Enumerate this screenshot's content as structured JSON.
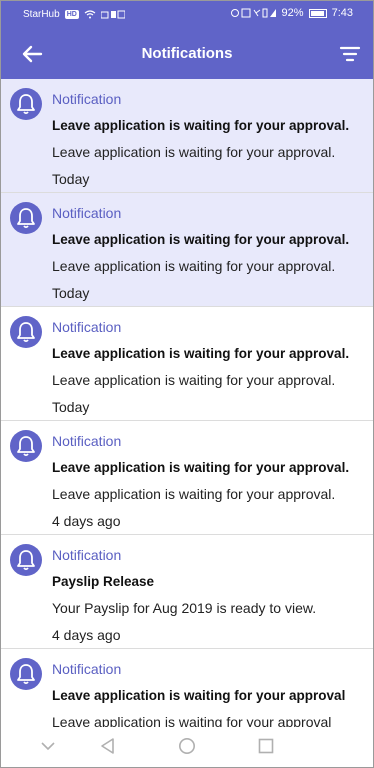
{
  "status_bar": {
    "carrier": "StarHub",
    "network_badge": "HD",
    "battery": "92%",
    "time": "7:43"
  },
  "app_bar": {
    "title": "Notifications",
    "back_icon": "arrow-left-icon",
    "filter_icon": "filter-icon"
  },
  "notifications": [
    {
      "category": "Notification",
      "subject": "Leave application is waiting for your approval.",
      "body": "Leave application is waiting for your approval.",
      "time": "Today",
      "unread": true
    },
    {
      "category": "Notification",
      "subject": "Leave application is waiting for your approval.",
      "body": "Leave application is waiting for your approval.",
      "time": "Today",
      "unread": true
    },
    {
      "category": "Notification",
      "subject": "Leave application is waiting for your approval.",
      "body": "Leave application is waiting for your approval.",
      "time": "Today",
      "unread": false
    },
    {
      "category": "Notification",
      "subject": "Leave application is waiting for your approval.",
      "body": "Leave application is waiting for your approval.",
      "time": "4 days ago",
      "unread": false
    },
    {
      "category": "Notification",
      "subject": "Payslip Release",
      "body": "Your Payslip for Aug 2019 is ready to view.",
      "time": "4 days ago",
      "unread": false
    },
    {
      "category": "Notification",
      "subject": "Leave application is waiting for your approval",
      "body": "Leave application is waiting for your approval",
      "time": "",
      "unread": false
    }
  ],
  "colors": {
    "primary": "#6064c8",
    "unread_background": "#e8e9fb",
    "category_text": "#5a5fc2"
  }
}
